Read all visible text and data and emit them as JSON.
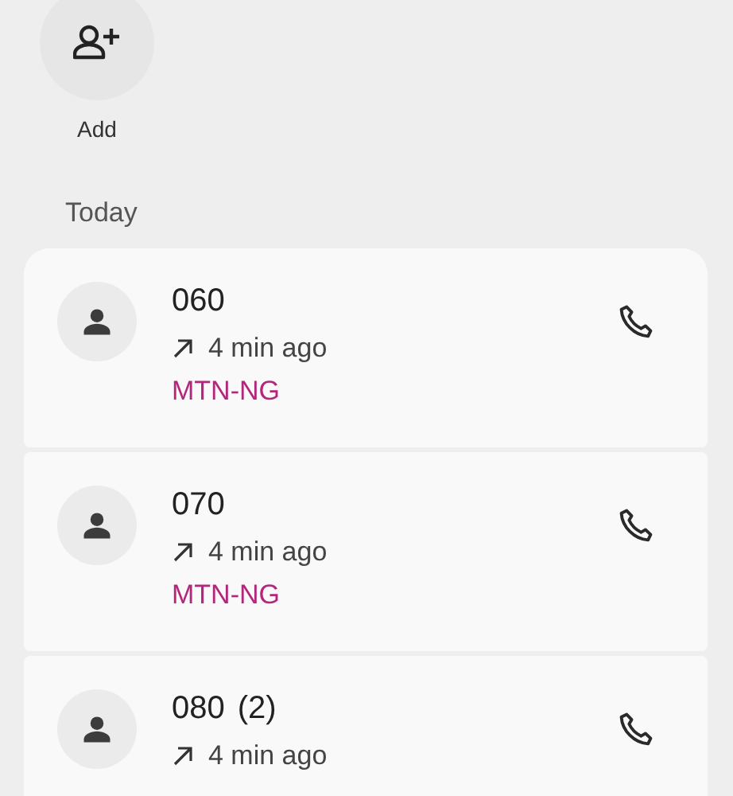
{
  "add_button": {
    "label": "Add"
  },
  "section_header": "Today",
  "calls": [
    {
      "number": "060",
      "kind": "outgoing",
      "time": "4 min ago",
      "carrier": "MTN-NG"
    },
    {
      "number": "070",
      "kind": "outgoing",
      "time": "4 min ago",
      "carrier": "MTN-NG"
    },
    {
      "number": "080",
      "count": "(2)",
      "kind": "outgoing",
      "time": "4 min ago"
    }
  ]
}
